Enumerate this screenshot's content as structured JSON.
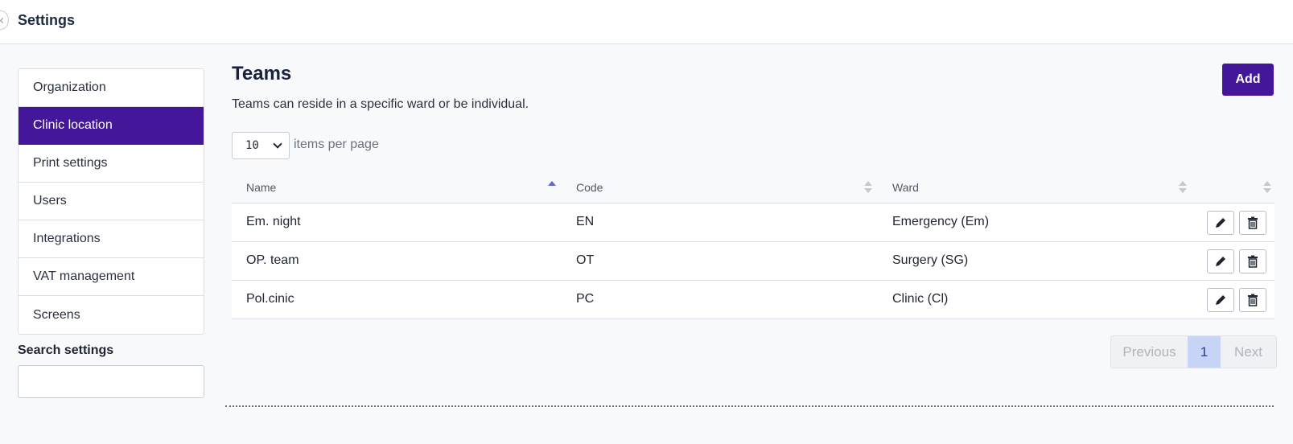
{
  "header": {
    "title": "Settings"
  },
  "sidebar": {
    "items": [
      {
        "label": "Organization",
        "active": false
      },
      {
        "label": "Clinic location",
        "active": true
      },
      {
        "label": "Print settings",
        "active": false
      },
      {
        "label": "Users",
        "active": false
      },
      {
        "label": "Integrations",
        "active": false
      },
      {
        "label": "VAT management",
        "active": false
      },
      {
        "label": "Screens",
        "active": false
      }
    ],
    "search_label": "Search settings",
    "search_value": ""
  },
  "main": {
    "title": "Teams",
    "description": "Teams can reside in a specific ward or be individual.",
    "add_label": "Add",
    "page_size": "10",
    "page_size_label": "items per page",
    "table": {
      "columns": [
        "Name",
        "Code",
        "Ward"
      ],
      "sorted_column": "Name",
      "sort_direction": "ascending",
      "rows": [
        {
          "name": "Em. night",
          "code": "EN",
          "ward": "Emergency (Em)"
        },
        {
          "name": "OP. team",
          "code": "OT",
          "ward": "Surgery (SG)"
        },
        {
          "name": "Pol.cinic",
          "code": "PC",
          "ward": "Clinic (Cl)"
        }
      ],
      "row_actions": [
        "pencil-icon",
        "trash-icon"
      ]
    },
    "pagination": {
      "previous": "Previous",
      "current": "1",
      "next": "Next"
    }
  },
  "colors": {
    "accent": "#44169a",
    "current_page": "#c7d4f5"
  }
}
